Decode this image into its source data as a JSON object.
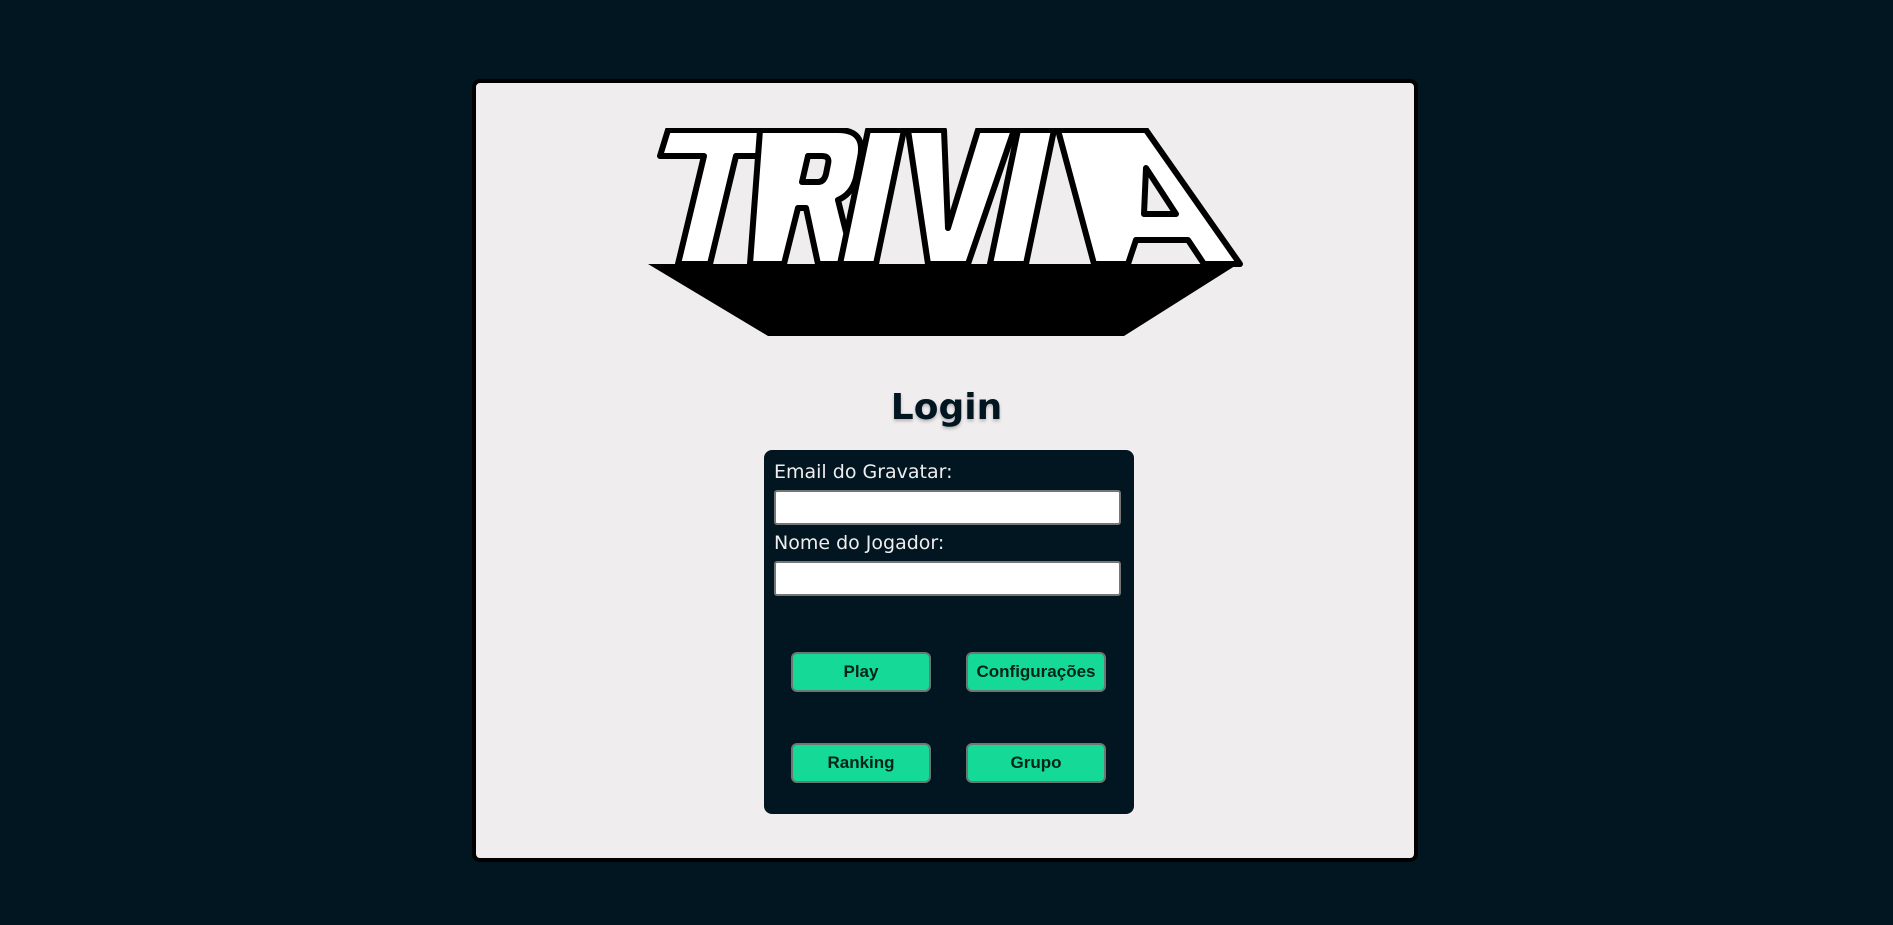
{
  "app": {
    "logo_text": "TRIVIA"
  },
  "page": {
    "title": "Login"
  },
  "form": {
    "email_label": "Email do Gravatar:",
    "email_value": "",
    "name_label": "Nome do Jogador:",
    "name_value": ""
  },
  "buttons": {
    "play": "Play",
    "settings": "Configurações",
    "ranking": "Ranking",
    "group": "Grupo"
  },
  "colors": {
    "background": "#011620",
    "card": "#f0edee",
    "panel": "#011620",
    "button": "#14d997"
  }
}
